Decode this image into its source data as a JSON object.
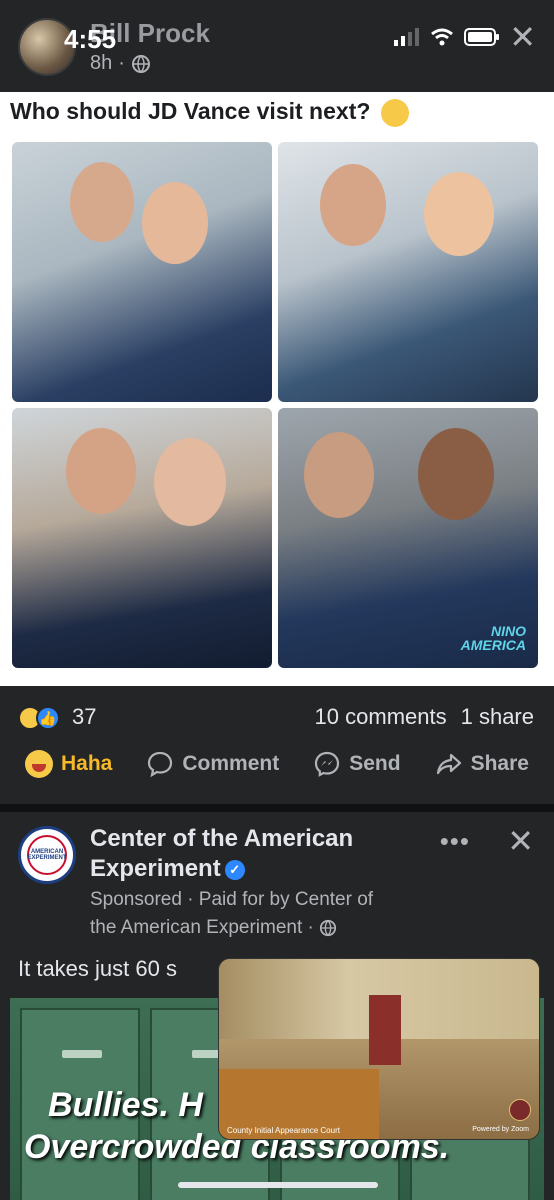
{
  "status_bar": {
    "time": "4:55",
    "icons": [
      "signal-icon",
      "wifi-icon",
      "battery-icon"
    ]
  },
  "post": {
    "author": "Bill Prock",
    "age": "8h",
    "audience_icon": "globe-icon",
    "caption": "Who should JD Vance visit next?",
    "caption_emoji": "thinking-face-icon",
    "image_watermark": [
      "NINO",
      "AMERICA"
    ],
    "reaction_count": "37",
    "comments": "10 comments",
    "shares": "1 share",
    "actions": {
      "haha": "Haha",
      "comment": "Comment",
      "send": "Send",
      "share": "Share"
    }
  },
  "sponsored_post": {
    "name_line1": "Center of the American",
    "name_line2": "Experiment",
    "logo_text": "AMERICAN EXPERIMENT",
    "sponsored_label": "Sponsored",
    "paid_for": "Paid for by Center of",
    "paid_for_line2": "the American Experiment",
    "text": "It takes just 60 s",
    "ad_headline1": "Bullies. H",
    "ad_headline2": "Overcrowded classrooms.",
    "pip_caption": "County Initial Appearance Court",
    "pip_powered": "Powered by Zoom"
  },
  "colors": {
    "background": "#242526",
    "haha_yellow": "#f7b928",
    "facebook_blue": "#2d88ff"
  }
}
